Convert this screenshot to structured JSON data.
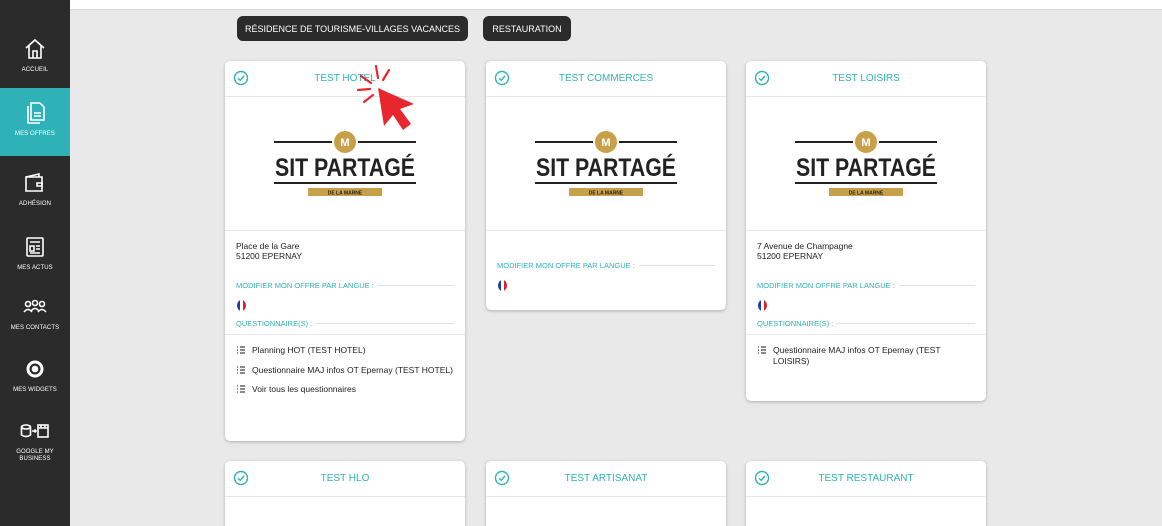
{
  "sidebar": {
    "items": [
      {
        "label": "ACCUEIL",
        "icon": "home-icon"
      },
      {
        "label": "MES OFFRES",
        "icon": "documents-icon",
        "active": true
      },
      {
        "label": "ADHÉSION",
        "icon": "wallet-icon"
      },
      {
        "label": "MES ACTUS",
        "icon": "news-icon"
      },
      {
        "label": "MES CONTACTS",
        "icon": "contacts-icon"
      },
      {
        "label": "MES WIDGETS",
        "icon": "gear-icon"
      },
      {
        "label": "GOOGLE MY BUSINESS",
        "icon": "database-store-icon"
      }
    ]
  },
  "filters": [
    {
      "label": "RÉSIDENCE DE TOURISME-VILLAGES VACANCES"
    },
    {
      "label": "RESTAURATION"
    }
  ],
  "logo": {
    "name": "SIT PARTAGÉ",
    "sub": "DE LA MARNE",
    "letter": "M"
  },
  "labels": {
    "modify_language": "MODIFIER MON OFFRE PAR LANGUE :",
    "questionnaires": "QUESTIONNAIRE(S) :"
  },
  "cards": [
    {
      "title": "TEST HOTEL",
      "address_line1": "Place de la Gare",
      "address_line2": "51200 EPERNAY",
      "questionnaires": [
        "Planning HOT (TEST HOTEL)",
        "Questionnaire MAJ infos OT Epernay (TEST HOTEL)",
        "Voir tous les questionnaires"
      ]
    },
    {
      "title": "TEST COMMERCES"
    },
    {
      "title": "TEST LOISIRS",
      "address_line1": "7 Avenue de Champagne",
      "address_line2": "51200 EPERNAY",
      "questionnaires": [
        "Questionnaire MAJ infos OT Epernay (TEST LOISIRS)"
      ]
    },
    {
      "title": "TEST HLO"
    },
    {
      "title": "TEST ARTISANAT"
    },
    {
      "title": "TEST RESTAURANT"
    }
  ],
  "colors": {
    "accent": "#2fb2b7",
    "sidebar": "#2b2b2b",
    "logo_gold": "#c9a04a",
    "cursor": "#e8262d"
  }
}
